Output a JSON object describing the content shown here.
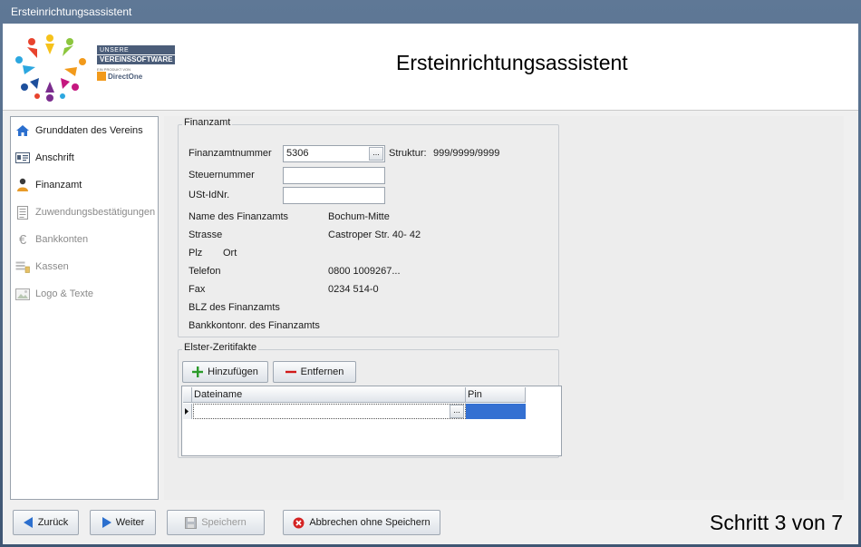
{
  "window": {
    "title": "Ersteinrichtungsassistent"
  },
  "header": {
    "title": "Ersteinrichtungsassistent",
    "brand_line1": "UNSERE",
    "brand_line2": "VEREINSSOFTWARE",
    "brand_small": "EIN PRODUKT VON",
    "brand_company": "DirectOne"
  },
  "sidebar": {
    "items": [
      {
        "label": "Grunddaten des Vereins",
        "icon": "home-icon",
        "enabled": true
      },
      {
        "label": "Anschrift",
        "icon": "id-card-icon",
        "enabled": true
      },
      {
        "label": "Finanzamt",
        "icon": "person-icon",
        "enabled": true
      },
      {
        "label": "Zuwendungsbestätigungen",
        "icon": "document-list-icon",
        "enabled": false
      },
      {
        "label": "Bankkonten",
        "icon": "euro-icon",
        "enabled": false
      },
      {
        "label": "Kassen",
        "icon": "cash-register-icon",
        "enabled": false
      },
      {
        "label": "Logo & Texte",
        "icon": "image-icon",
        "enabled": false
      }
    ]
  },
  "finanzamt": {
    "legend": "Finanzamt",
    "nummer_label": "Finanzamtnummer",
    "nummer_value": "5306",
    "struktur_label": "Struktur:",
    "struktur_value": "999/9999/9999",
    "steuernummer_label": "Steuernummer",
    "steuernummer_value": "",
    "ustid_label": "USt-IdNr.",
    "ustid_value": "",
    "name_label": "Name des Finanzamts",
    "name_value": "Bochum-Mitte",
    "strasse_label": "Strasse",
    "strasse_value": "Castroper Str. 40- 42",
    "plz_label": "Plz",
    "ort_label": "Ort",
    "telefon_label": "Telefon",
    "telefon_value": "0800 1009267...",
    "fax_label": "Fax",
    "fax_value": "0234 514-0",
    "blz_label": "BLZ des Finanzamts",
    "konto_label": "Bankkontonr. des Finanzamts"
  },
  "elster": {
    "legend": "Elster-Zeritifakte",
    "add_label": "Hinzufügen",
    "remove_label": "Entfernen",
    "columns": [
      "Dateiname",
      "Pin"
    ]
  },
  "footer": {
    "back_label": "Zurück",
    "next_label": "Weiter",
    "save_label": "Speichern",
    "cancel_label": "Abbrechen ohne Speichern",
    "step_text": "Schritt 3 von 7"
  },
  "colors": {
    "accent_blue": "#3a6fd0",
    "selection_blue": "#3470d2",
    "remove_red": "#d11a1a",
    "add_green": "#2a9a2a"
  }
}
